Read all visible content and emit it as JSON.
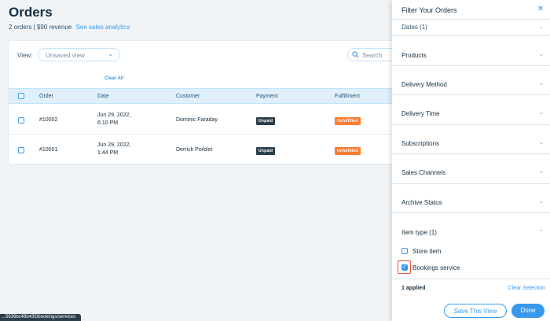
{
  "page": {
    "title": "Orders",
    "summary": "2 orders | $90 revenue",
    "analytics_link": "See sales analytics"
  },
  "toolbar": {
    "view_label": "View:",
    "view_value": "Unsaved view",
    "search_placeholder": "Search",
    "clear_all": "Clear All"
  },
  "table": {
    "columns": [
      "Order",
      "Date",
      "Customer",
      "Payment",
      "Fulfillment"
    ],
    "rows": [
      {
        "order": "#10002",
        "date_line1": "Jun 29, 2022,",
        "date_line2": "6:10 PM",
        "customer": "Dominic Faraday",
        "payment": "Unpaid",
        "fulfillment": "Unfulfilled"
      },
      {
        "order": "#10001",
        "date_line1": "Jun 29, 2022,",
        "date_line2": "1:44 PM",
        "customer": "Derrick Porblet",
        "payment": "Unpaid",
        "fulfillment": "Unfulfilled"
      }
    ]
  },
  "status_bar": {
    "url": "...5636bc48b435/bookings/services"
  },
  "filter_panel": {
    "title": "Filter Your Orders",
    "sections": [
      {
        "label": "Dates (1)"
      },
      {
        "label": "Products"
      },
      {
        "label": "Delivery Method"
      },
      {
        "label": "Delivery Time"
      },
      {
        "label": "Subscriptions"
      },
      {
        "label": "Sales Channels"
      },
      {
        "label": "Archive Status"
      },
      {
        "label": "Item type (1)"
      }
    ],
    "item_type_options": [
      {
        "label": "Store item",
        "checked": false
      },
      {
        "label": "Bookings service",
        "checked": true
      }
    ],
    "applied": "1 applied",
    "clear_selection": "Clear Selection",
    "save_button": "Save This View",
    "done_button": "Done"
  },
  "colors": {
    "accent": "#3899ec",
    "unpaid_badge": "#2b3e4c",
    "unfulfilled_badge": "#fb7d33",
    "highlight": "#e0533b"
  }
}
